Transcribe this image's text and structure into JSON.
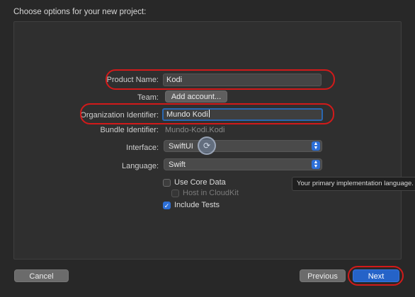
{
  "dialog": {
    "header": "Choose options for your new project:"
  },
  "form": {
    "product_name": {
      "label": "Product Name:",
      "value": "Kodi"
    },
    "team": {
      "label": "Team:",
      "button": "Add account..."
    },
    "organization_identifier": {
      "label": "Organization Identifier:",
      "value": "Mundo Kodi"
    },
    "bundle_identifier": {
      "label": "Bundle Identifier:",
      "value": "Mundo-Kodi.Kodi"
    },
    "interface": {
      "label": "Interface:",
      "selected": "SwiftUI"
    },
    "language": {
      "label": "Language:",
      "selected": "Swift"
    },
    "options": {
      "use_core_data": {
        "label": "Use Core Data",
        "checked": false
      },
      "host_in_cloudkit": {
        "label": "Host in CloudKit",
        "checked": false,
        "enabled": false
      },
      "include_tests": {
        "label": "Include Tests",
        "checked": true
      }
    }
  },
  "tooltip": {
    "text": "Your primary implementation language."
  },
  "footer": {
    "cancel": "Cancel",
    "previous": "Previous",
    "next": "Next"
  },
  "colors": {
    "highlight": "#d21a1a",
    "accent": "#2563c8"
  },
  "icons": {
    "cursor": "cursor-click-icon",
    "stepper": "chevron-up-down-icon",
    "check": "checkmark-icon"
  }
}
